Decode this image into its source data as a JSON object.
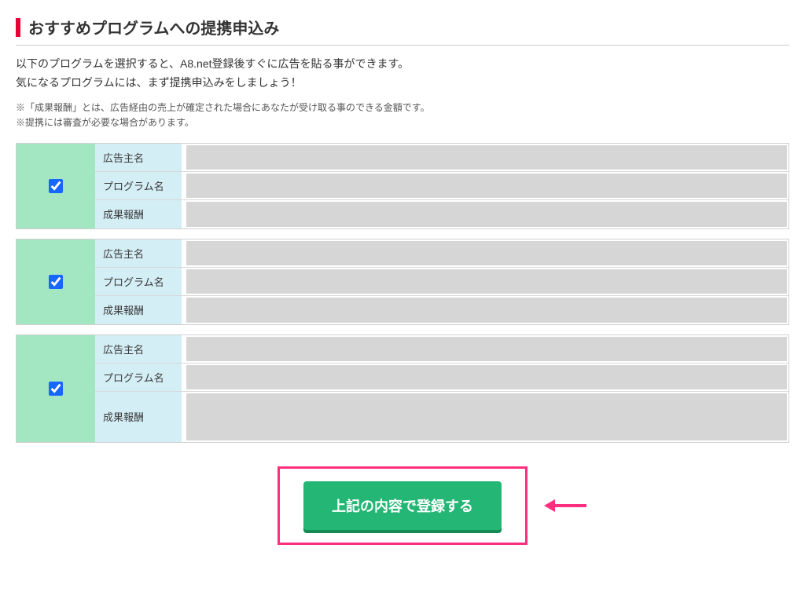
{
  "heading": "おすすめプログラムへの提携申込み",
  "intro_line1": "以下のプログラムを選択すると、A8.net登録後すぐに広告を貼る事ができます。",
  "intro_line2": "気になるプログラムには、まず提携申込みをしましょう！",
  "note_line1": "※「成果報酬」とは、広告経由の売上が確定された場合にあなたが受け取る事のできる金額です。",
  "note_line2": "※提携には審査が必要な場合があります。",
  "labels": {
    "advertiser": "広告主名",
    "program": "プログラム名",
    "reward": "成果報酬"
  },
  "programs": [
    {
      "advertiser": "",
      "program": "",
      "reward": "",
      "tall_reward": false
    },
    {
      "advertiser": "",
      "program": "",
      "reward": "",
      "tall_reward": false
    },
    {
      "advertiser": "",
      "program": "",
      "reward": "",
      "tall_reward": true
    }
  ],
  "submit_label": "上記の内容で登録する"
}
